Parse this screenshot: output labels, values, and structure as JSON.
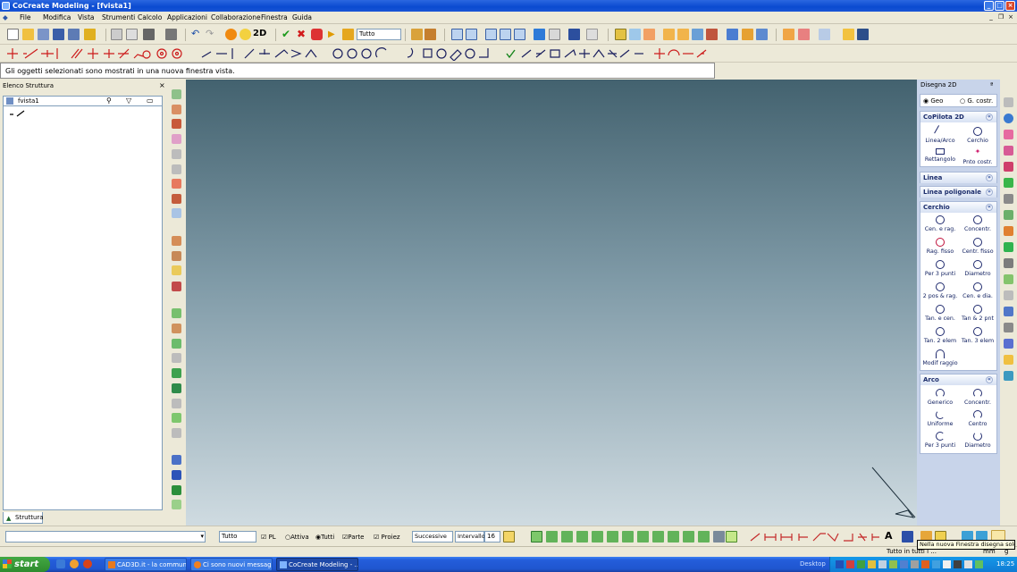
{
  "window": {
    "title": "CoCreate Modeling - [fvista1]"
  },
  "menu": [
    "File",
    "Modifica",
    "Vista",
    "Strumenti",
    "Calcolo",
    "Applicazioni",
    "Collaborazione",
    "Finestra",
    "Guida"
  ],
  "toolbar": {
    "selection_filter": "Tutto",
    "mode_2d": "2D"
  },
  "message": "Gli oggetti selezionati sono mostrati in una nuova finestra vista.",
  "structure": {
    "title": "Elenco Struttura",
    "root": "fvista1",
    "tab": "Struttura"
  },
  "right_panel": {
    "title": "Disegna 2D",
    "radio_geo": "Geo",
    "radio_costr": "G. costr.",
    "copilota": {
      "title": "CoPilota 2D",
      "items": [
        "Linea/Arco",
        "Cerchio",
        "Rettangolo",
        "Pnto costr."
      ]
    },
    "linea": {
      "title": "Linea"
    },
    "poligonale": {
      "title": "Linea poligonale"
    },
    "cerchio": {
      "title": "Cerchio",
      "items": [
        "Cen. e rag.",
        "Concentr.",
        "Rag. fisso",
        "Centr. fisso",
        "Per 3 punti",
        "Diametro",
        "2 pos & rag.",
        "Cen. e dia.",
        "Tan. e cen.",
        "Tan & 2 pnt",
        "Tan. 2 elem",
        "Tan. 3 elem",
        "Modif raggio"
      ]
    },
    "arco": {
      "title": "Arco",
      "items": [
        "Generico",
        "Concentr.",
        "Uniforme",
        "Centro",
        "Per 3 punti",
        "Diametro"
      ]
    }
  },
  "bottombar": {
    "filter": "Tutto",
    "chk_pl": "PL",
    "radio_attiva": "Attiva",
    "radio_tutti": "Tutti",
    "chk_parte": "Parte",
    "chk_proiez": "Proiez",
    "successive": "Successive",
    "intervallo": "Intervallo",
    "intervallo_value": "16"
  },
  "tooltip": "Nella nuova Finestra disegna solo ...",
  "status": {
    "right": "Tutto in tutti i ...",
    "right2": "mm",
    "right3": "g"
  },
  "taskbar": {
    "start": "start",
    "tasks": [
      "CAD3D.it - la commun...",
      "Ci sono nuovi messag...",
      "CoCreate Modeling - ..."
    ],
    "desktop": "Desktop",
    "clock": "18:25"
  }
}
